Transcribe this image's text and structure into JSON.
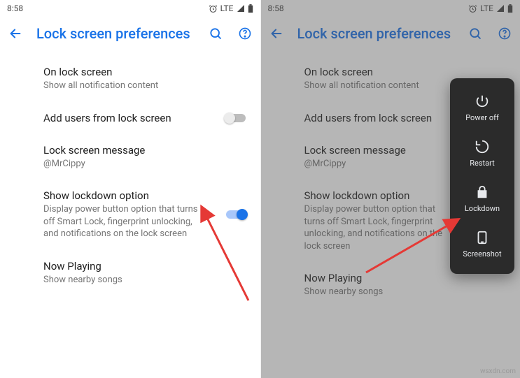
{
  "status": {
    "time": "8:58",
    "net": "LTE"
  },
  "header": {
    "title": "Lock screen preferences"
  },
  "items": {
    "onlock": {
      "label": "On lock screen",
      "sub": "Show all notification content"
    },
    "addusers": {
      "label": "Add users from lock screen"
    },
    "message": {
      "label": "Lock screen message",
      "sub": "@MrCippy"
    },
    "lockdown": {
      "label": "Show lockdown option",
      "sub": "Display power button option that turns off Smart Lock, fingerprint unlocking, and notifications on the lock screen"
    },
    "nowplay": {
      "label": "Now Playing",
      "sub": "Show nearby songs"
    }
  },
  "powermenu": {
    "poweroff": "Power off",
    "restart": "Restart",
    "lockdown": "Lockdown",
    "screenshot": "Screenshot"
  },
  "watermark": "wsxdn.com"
}
